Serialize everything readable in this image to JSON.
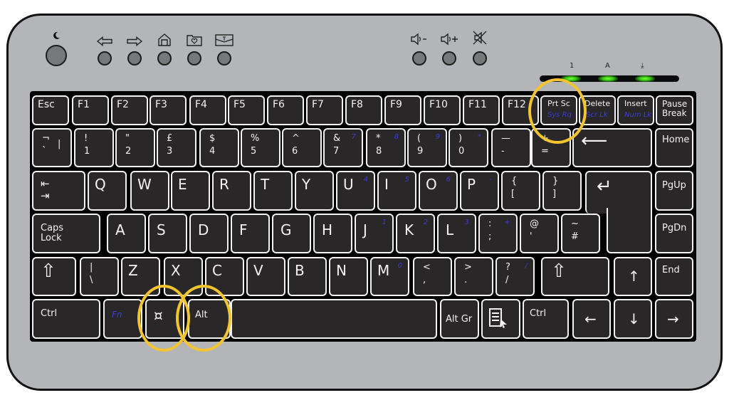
{
  "media_buttons": {
    "sleep": {
      "icon": "moon-icon"
    },
    "left_group": [
      {
        "icon": "back-arrow-icon"
      },
      {
        "icon": "forward-arrow-icon"
      },
      {
        "icon": "home-icon"
      },
      {
        "icon": "favorites-folder-icon"
      },
      {
        "icon": "mail-icon"
      }
    ],
    "right_group": [
      {
        "icon": "volume-down-icon",
        "label": "-"
      },
      {
        "icon": "volume-up-icon",
        "label": "+"
      },
      {
        "icon": "mute-icon"
      }
    ]
  },
  "indicators": {
    "labels": [
      "1",
      "A",
      "⤓"
    ],
    "names": [
      "num-lock",
      "caps-lock",
      "scroll-lock"
    ],
    "state": [
      "on",
      "on",
      "on"
    ],
    "color": "#4fe21e"
  },
  "keys": {
    "row0": [
      "Esc",
      "F1",
      "F2",
      "F3",
      "F4",
      "F5",
      "F6",
      "F7",
      "F8",
      "F9",
      "F10",
      "F11",
      "F12"
    ],
    "prtsc": {
      "main": "Prt Sc",
      "alt": "Sys Rq"
    },
    "delete": {
      "main": "Delete",
      "alt": "Scr Lk"
    },
    "insert": {
      "main": "Insert",
      "alt": "Num Lk"
    },
    "pause": "Pause\nBreak",
    "row1": [
      {
        "top": "¬",
        "bot": "`",
        "extra": "|"
      },
      {
        "top": "!",
        "bot": "1"
      },
      {
        "top": "\"",
        "bot": "2"
      },
      {
        "top": "£",
        "bot": "3"
      },
      {
        "top": "$",
        "bot": "4"
      },
      {
        "top": "%",
        "bot": "5"
      },
      {
        "top": "^",
        "bot": "6"
      },
      {
        "top": "&",
        "bot": "7",
        "blue": "7"
      },
      {
        "top": "*",
        "bot": "8",
        "blue": "8"
      },
      {
        "top": "(",
        "bot": "9",
        "blue": "9"
      },
      {
        "top": ")",
        "bot": "0",
        "blue": "*"
      },
      {
        "top": "—",
        "bot": "-"
      },
      {
        "top": "+",
        "bot": "="
      }
    ],
    "backspace": "⟵",
    "home": "Home",
    "tab": "⇤\n⇥",
    "row2": [
      {
        "main": "Q"
      },
      {
        "main": "W"
      },
      {
        "main": "E"
      },
      {
        "main": "R"
      },
      {
        "main": "T"
      },
      {
        "main": "Y"
      },
      {
        "main": "U",
        "blue": "4"
      },
      {
        "main": "I",
        "blue": "5"
      },
      {
        "main": "O",
        "blue": "6"
      },
      {
        "main": "P",
        "blue": "-"
      },
      {
        "top": "{",
        "bot": "["
      },
      {
        "top": "}",
        "bot": "]"
      }
    ],
    "enter": "↵",
    "pgup": "PgUp",
    "caps": "Caps\nLock",
    "row3": [
      {
        "main": "A"
      },
      {
        "main": "S"
      },
      {
        "main": "D"
      },
      {
        "main": "F"
      },
      {
        "main": "G"
      },
      {
        "main": "H"
      },
      {
        "main": "J",
        "blue": "1"
      },
      {
        "main": "K",
        "blue": "2"
      },
      {
        "main": "L",
        "blue": "3"
      },
      {
        "top": ":",
        "bot": ";",
        "blue": "+"
      },
      {
        "top": "@",
        "bot": "'"
      },
      {
        "top": "~",
        "bot": "#"
      }
    ],
    "pgdn": "PgDn",
    "lshift": "⇧",
    "row4": [
      {
        "top": "|",
        "bot": "\\"
      },
      {
        "main": "Z"
      },
      {
        "main": "X"
      },
      {
        "main": "C"
      },
      {
        "main": "V"
      },
      {
        "main": "B"
      },
      {
        "main": "N"
      },
      {
        "main": "M",
        "blue": "0"
      },
      {
        "top": "<",
        "bot": ","
      },
      {
        "top": ">",
        "bot": "."
      },
      {
        "top": "?",
        "bot": "/",
        "blue": "/"
      }
    ],
    "rshift": "⇧",
    "up": "↑",
    "end": "End",
    "lctrl": "Ctrl",
    "fn": "Fn",
    "win": "¤",
    "alt": "Alt",
    "space": "",
    "altgr": "Alt Gr",
    "menu": "menu-key",
    "rctrl": "Ctrl",
    "left": "←",
    "down": "↓",
    "right": "→"
  },
  "highlights": [
    {
      "target": "prtsc-key",
      "color": "#f2c430"
    },
    {
      "target": "win-key",
      "color": "#f2c430"
    },
    {
      "target": "alt-key",
      "color": "#f2c430"
    }
  ]
}
